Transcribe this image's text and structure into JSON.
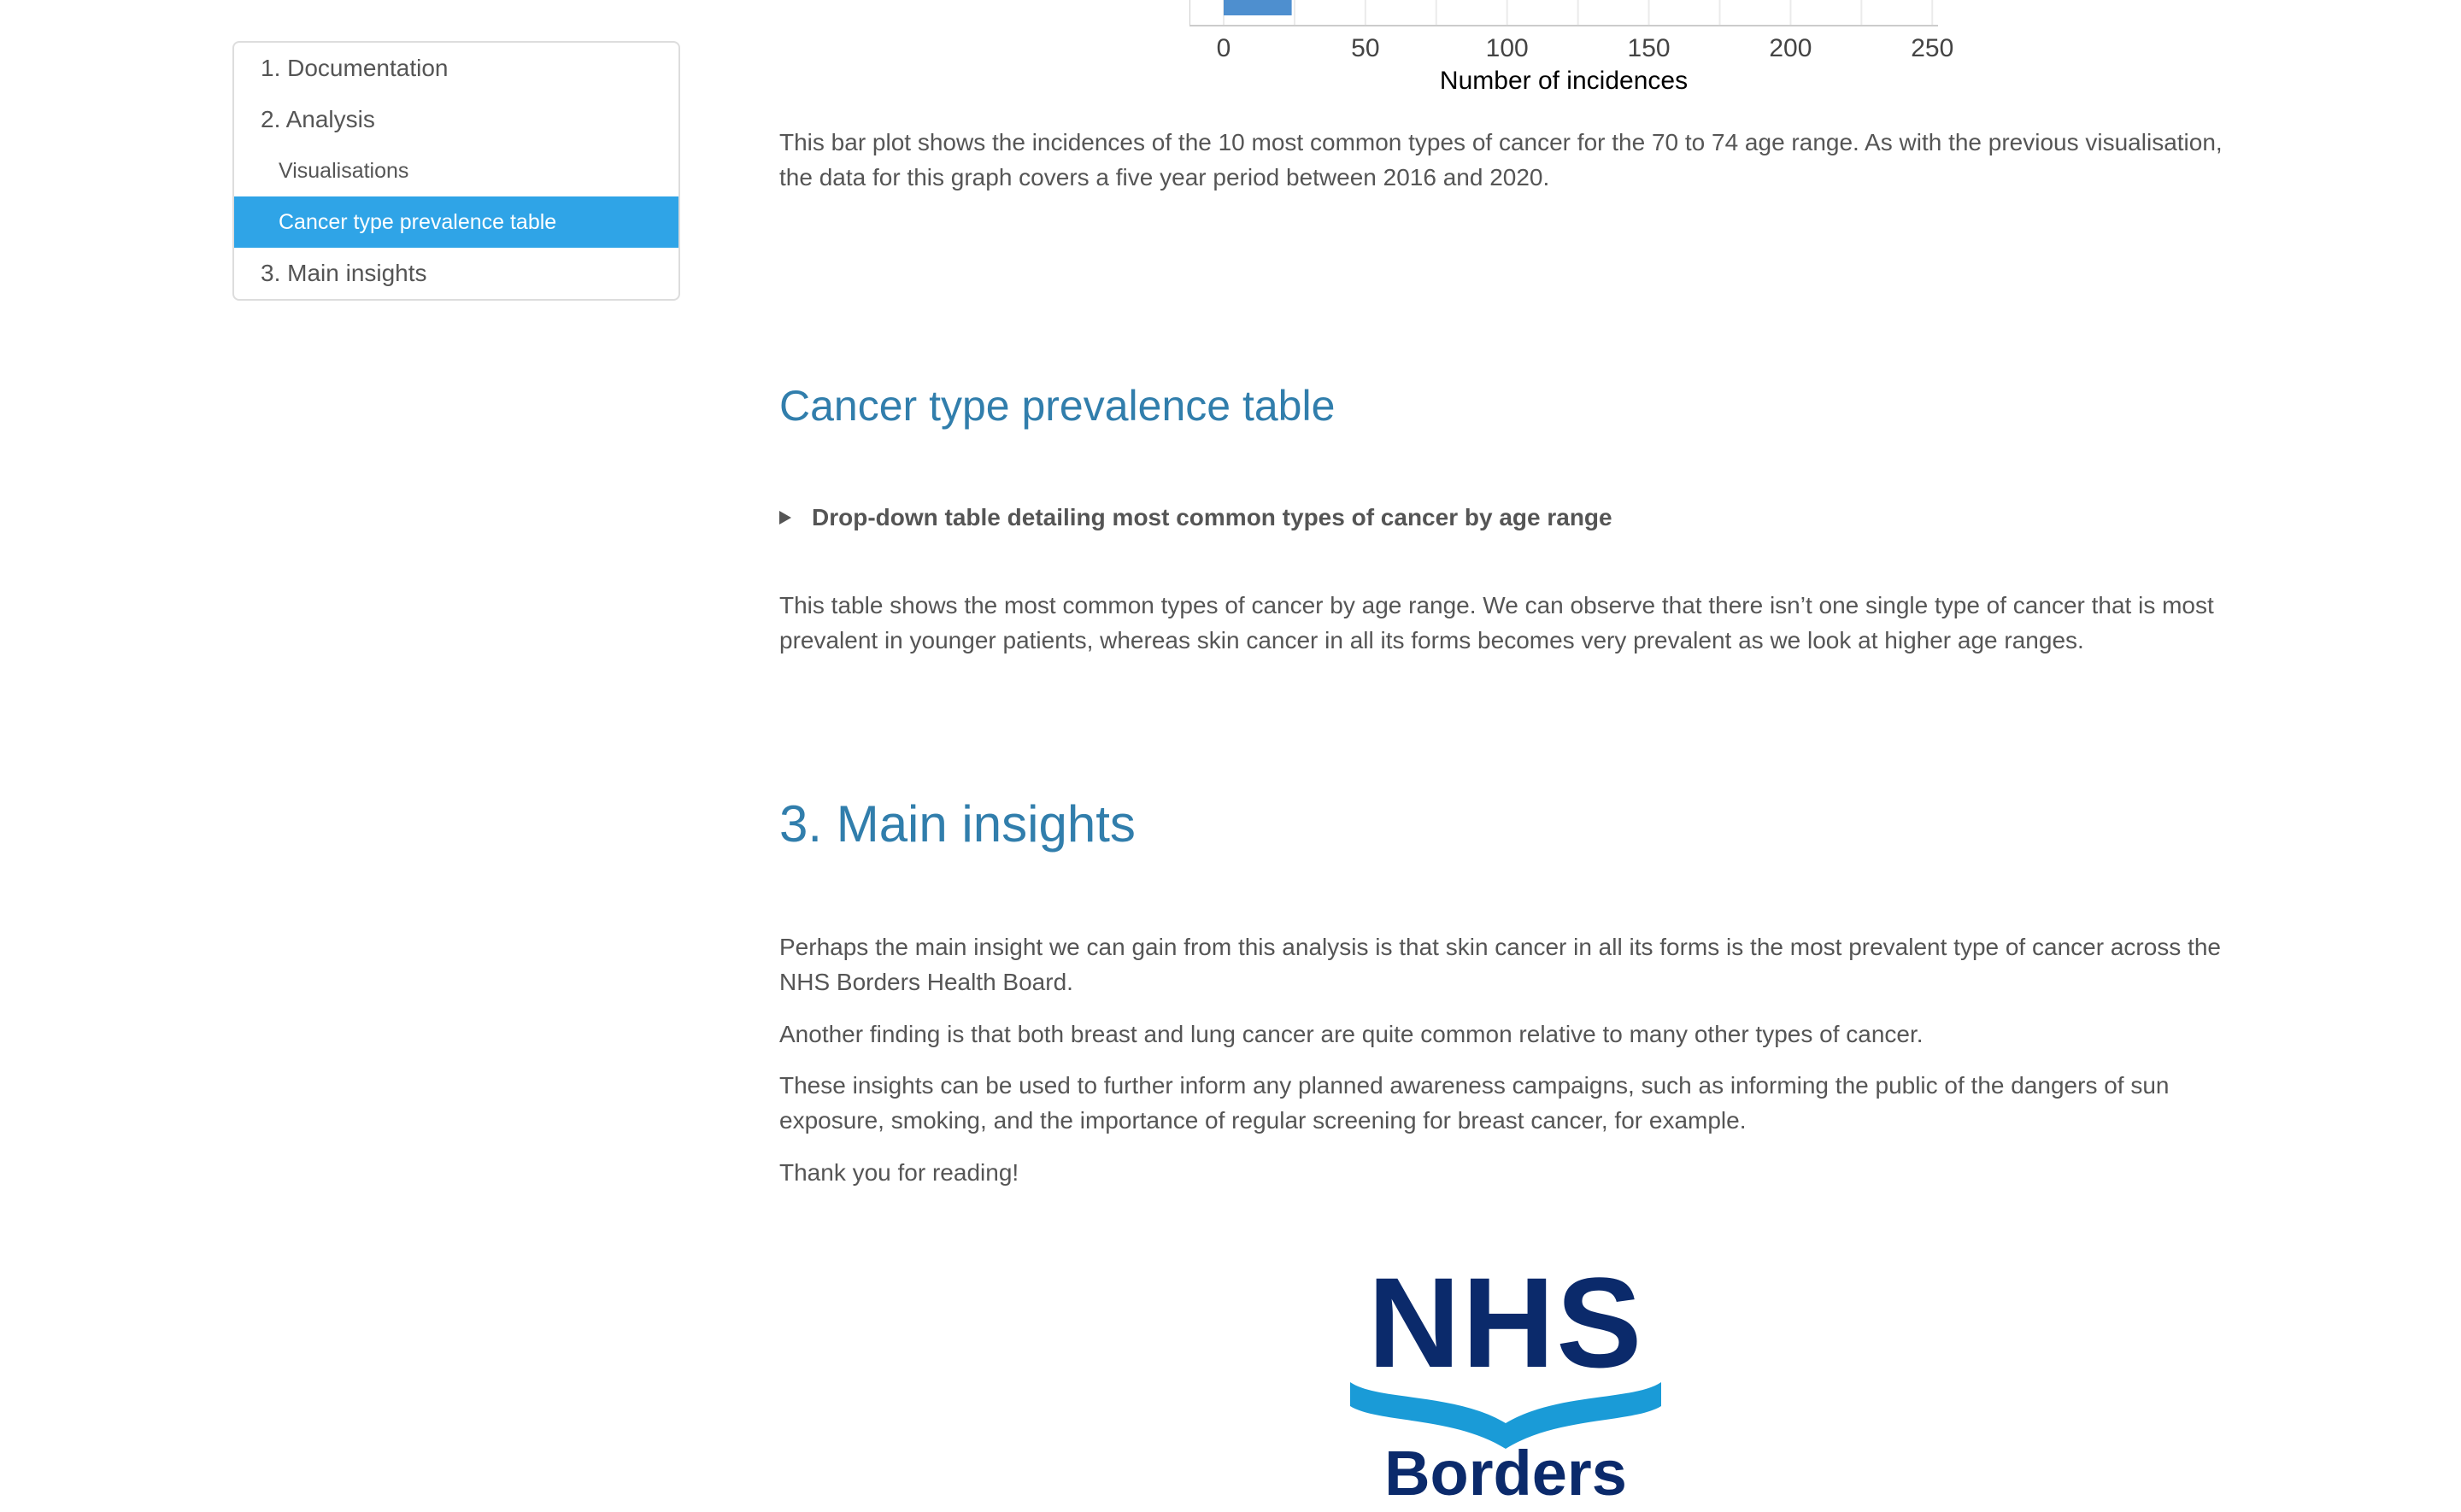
{
  "toc": {
    "items": [
      {
        "label": "1. Documentation",
        "level": 1,
        "active": false
      },
      {
        "label": "2. Analysis",
        "level": 1,
        "active": false
      },
      {
        "label": "Visualisations",
        "level": 2,
        "active": false
      },
      {
        "label": "Cancer type prevalence table",
        "level": 2,
        "active": true
      },
      {
        "label": "3. Main insights",
        "level": 1,
        "active": false
      }
    ],
    "active_color": "#2fa4e7"
  },
  "chart_data": {
    "type": "bar",
    "orientation": "horizontal",
    "xlabel": "Number of incidences",
    "x_ticks": [
      "0",
      "50",
      "100",
      "150",
      "200",
      "250"
    ],
    "xlim": [
      0,
      260
    ],
    "grid": true,
    "bar_color": "#4e8fcf",
    "visible_bar_values": [
      24
    ]
  },
  "content": {
    "chart_caption": "This bar plot shows the incidences of the 10 most common types of cancer for the 70 to 74 age range. As with the previous visualisation, the data for this graph covers a five year period between 2016 and 2020.",
    "section_table_heading": "Cancer type prevalence table",
    "dropdown_summary": "Drop-down table detailing most common types of cancer by age range",
    "table_caption": "This table shows the most common types of cancer by age range. We can observe that there isn’t one single type of cancer that is most prevalent in younger patients, whereas skin cancer in all its forms becomes very prevalent as we look at higher age ranges.",
    "insights_heading": "3. Main insights",
    "insights": [
      "Perhaps the main insight we can gain from this analysis is that skin cancer in all its forms is the most prevalent type of cancer across the NHS Borders Health Board.",
      "Another finding is that both breast and lung cancer are quite common relative to many other types of cancer.",
      "These insights can be used to further inform any planned awareness campaigns, such as informing the public of the dangers of sun exposure, smoking, and the importance of regular screening for breast cancer, for example.",
      "Thank you for reading!"
    ],
    "heading_color": "#317eac"
  },
  "logo": {
    "top_text": "NHS",
    "bottom_text": "Borders",
    "dark_color": "#0b2a6b",
    "wave_color": "#1a9bd7"
  }
}
